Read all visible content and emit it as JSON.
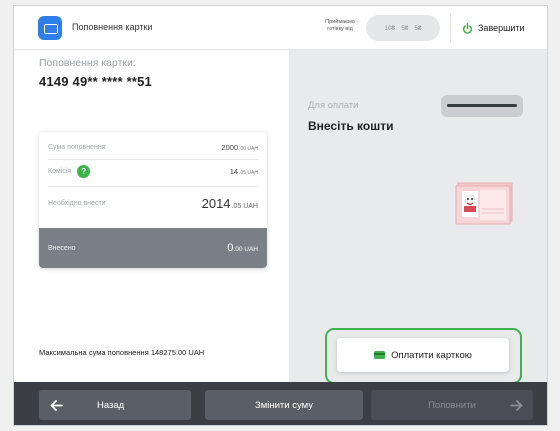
{
  "header": {
    "title": "Поповнення картки",
    "accepts_label": "Приймаємо готівку від",
    "denominations": [
      "10₴",
      "5₴",
      "5₴"
    ],
    "finish_label": "Завершити"
  },
  "left": {
    "topup_label": "Поповнення картки:",
    "card_number": "4149 49** **** **51",
    "summary": {
      "amount_label": "Сума поповнення",
      "amount_value": "2000",
      "amount_decimals": ".00 UAH",
      "fee_label": "Комісія",
      "fee_value": "14",
      "fee_decimals": ".05 UAH",
      "due_label": "Необхідно внести",
      "due_value": "2014",
      "due_decimals": ".05 UAH",
      "paid_label": "Внесено",
      "paid_value": "0",
      "paid_decimals": ".00 UAH"
    },
    "max_note": "Максимальна сума поповнення 148275.00 UAH"
  },
  "right": {
    "for_payment": "Для оплати",
    "insert_cash": "Внесіть кошти",
    "pay_card_label": "Оплатити карткою"
  },
  "footer": {
    "back_label": "Назад",
    "change_label": "Змінити суму",
    "topup_label": "Поповнити"
  },
  "colors": {
    "accent_blue": "#2f7fe8",
    "accent_green": "#3fb24f",
    "footer_bg": "#3b3f44",
    "paid_bar_bg": "#7b8086"
  },
  "icons": {
    "app": "card-app-icon",
    "finish": "power-icon",
    "fee_help": "question-icon",
    "pay_card": "card-icon",
    "back": "arrow-left-icon",
    "next": "arrow-right-icon"
  }
}
